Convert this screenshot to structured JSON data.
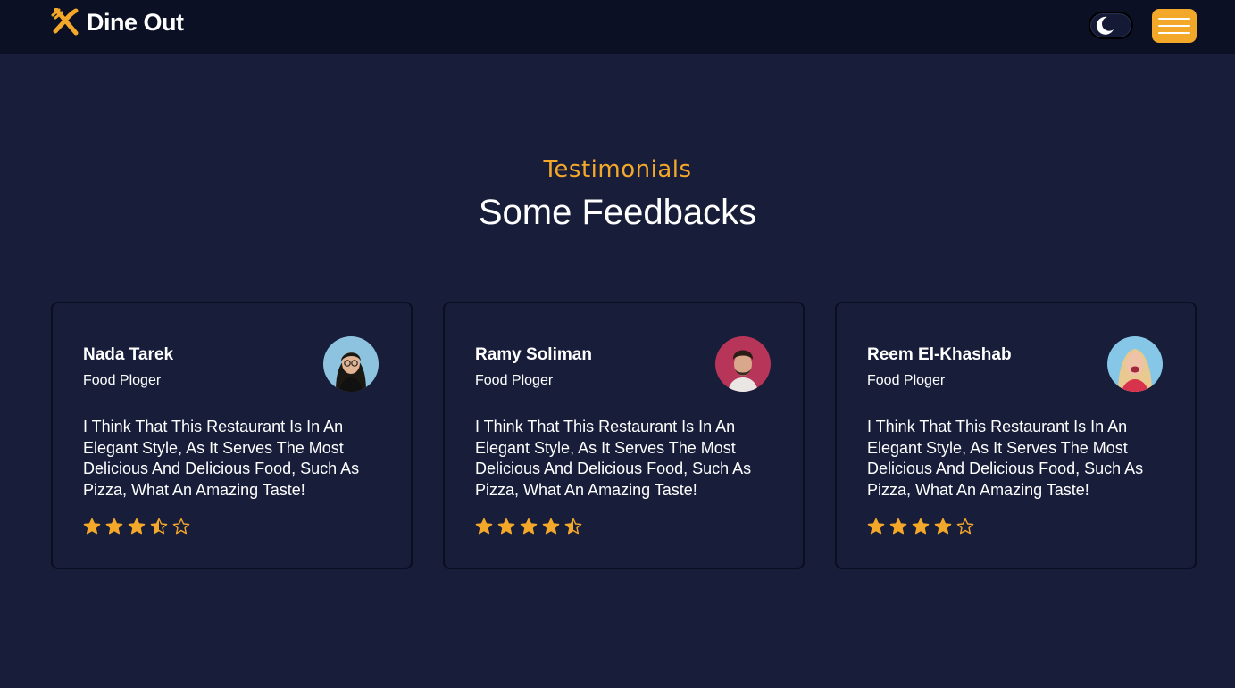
{
  "nav": {
    "brand": "Dine Out",
    "logo_icon": "fork-knife-icon",
    "theme_icon": "moon-icon",
    "menu_icon": "hamburger-menu-icon"
  },
  "section": {
    "eyebrow": "Testimonials",
    "title": "Some Feedbacks"
  },
  "testimonials": [
    {
      "name": "Nada Tarek",
      "role": "Food Ploger",
      "text": "I Think That This Restaurant Is In An Elegant Style, As It Serves The Most Delicious And Delicious Food, Such As Pizza, What An Amazing Taste!",
      "rating": 3.5,
      "avatar": "woman-with-glasses-avatar"
    },
    {
      "name": "Ramy Soliman",
      "role": "Food Ploger",
      "text": "I Think That This Restaurant Is In An Elegant Style, As It Serves The Most Delicious And Delicious Food, Such As Pizza, What An Amazing Taste!",
      "rating": 4.5,
      "avatar": "bearded-man-avatar"
    },
    {
      "name": "Reem El-Khashab",
      "role": "Food Ploger",
      "text": "I Think That This Restaurant Is In An Elegant Style, As It Serves The Most Delicious And Delicious Food, Such As Pizza, What An Amazing Taste!",
      "rating": 4,
      "avatar": "laughing-woman-avatar"
    }
  ],
  "colors": {
    "accent": "#f4a82a",
    "background": "#181d3a",
    "navbar": "#0b1025"
  }
}
